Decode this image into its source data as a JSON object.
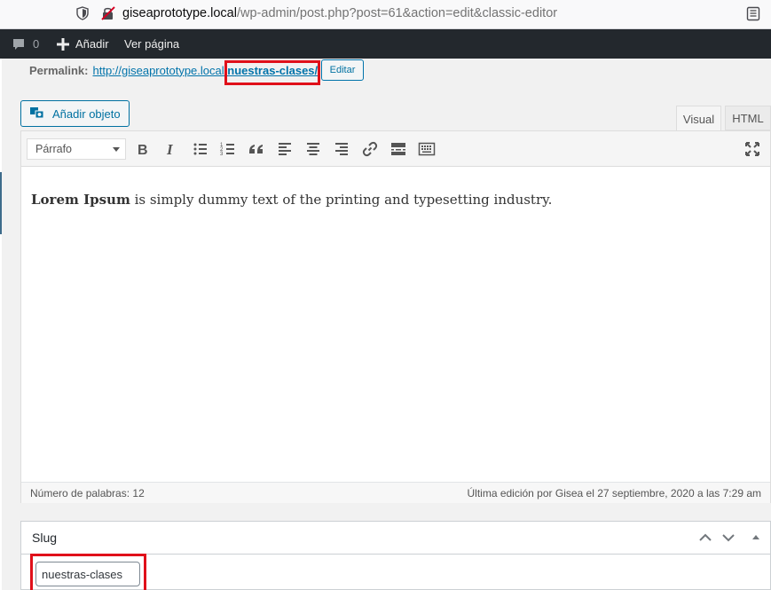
{
  "browser": {
    "url_host": "giseaprototype.local",
    "url_path": "/wp-admin/post.php?post=61&action=edit&classic-editor"
  },
  "adminbar": {
    "comments_count": "0",
    "new_label": "Añadir",
    "view_label": "Ver página"
  },
  "permalink": {
    "label": "Permalink:",
    "base_url": "http://giseaprototype.local",
    "slug": "/nuestras-clases/",
    "edit_label": "Editar"
  },
  "editor": {
    "add_media_label": "Añadir objeto",
    "tabs": [
      {
        "label": "Visual",
        "active": true
      },
      {
        "label": "HTML",
        "active": false
      }
    ],
    "format_select": "Párrafo",
    "toolbar_icons": [
      "bold-icon",
      "italic-icon",
      "bullet-list-icon",
      "numbered-list-icon",
      "blockquote-icon",
      "align-left-icon",
      "align-center-icon",
      "align-right-icon",
      "link-icon",
      "read-more-icon",
      "toolbar-toggle-icon",
      "fullscreen-icon"
    ],
    "content_bold": "Lorem Ipsum",
    "content_rest": " is simply dummy text of the printing and typesetting industry.",
    "word_count": "Número de palabras: 12",
    "last_edit": "Última edición por Gisea el 27 septiembre, 2020 a las 7:29 am"
  },
  "slug_box": {
    "title": "Slug",
    "value": "nuestras-clases"
  },
  "colors": {
    "highlight": "#e0101a",
    "link": "#0073aa",
    "adminbar_bg": "#23282d"
  }
}
